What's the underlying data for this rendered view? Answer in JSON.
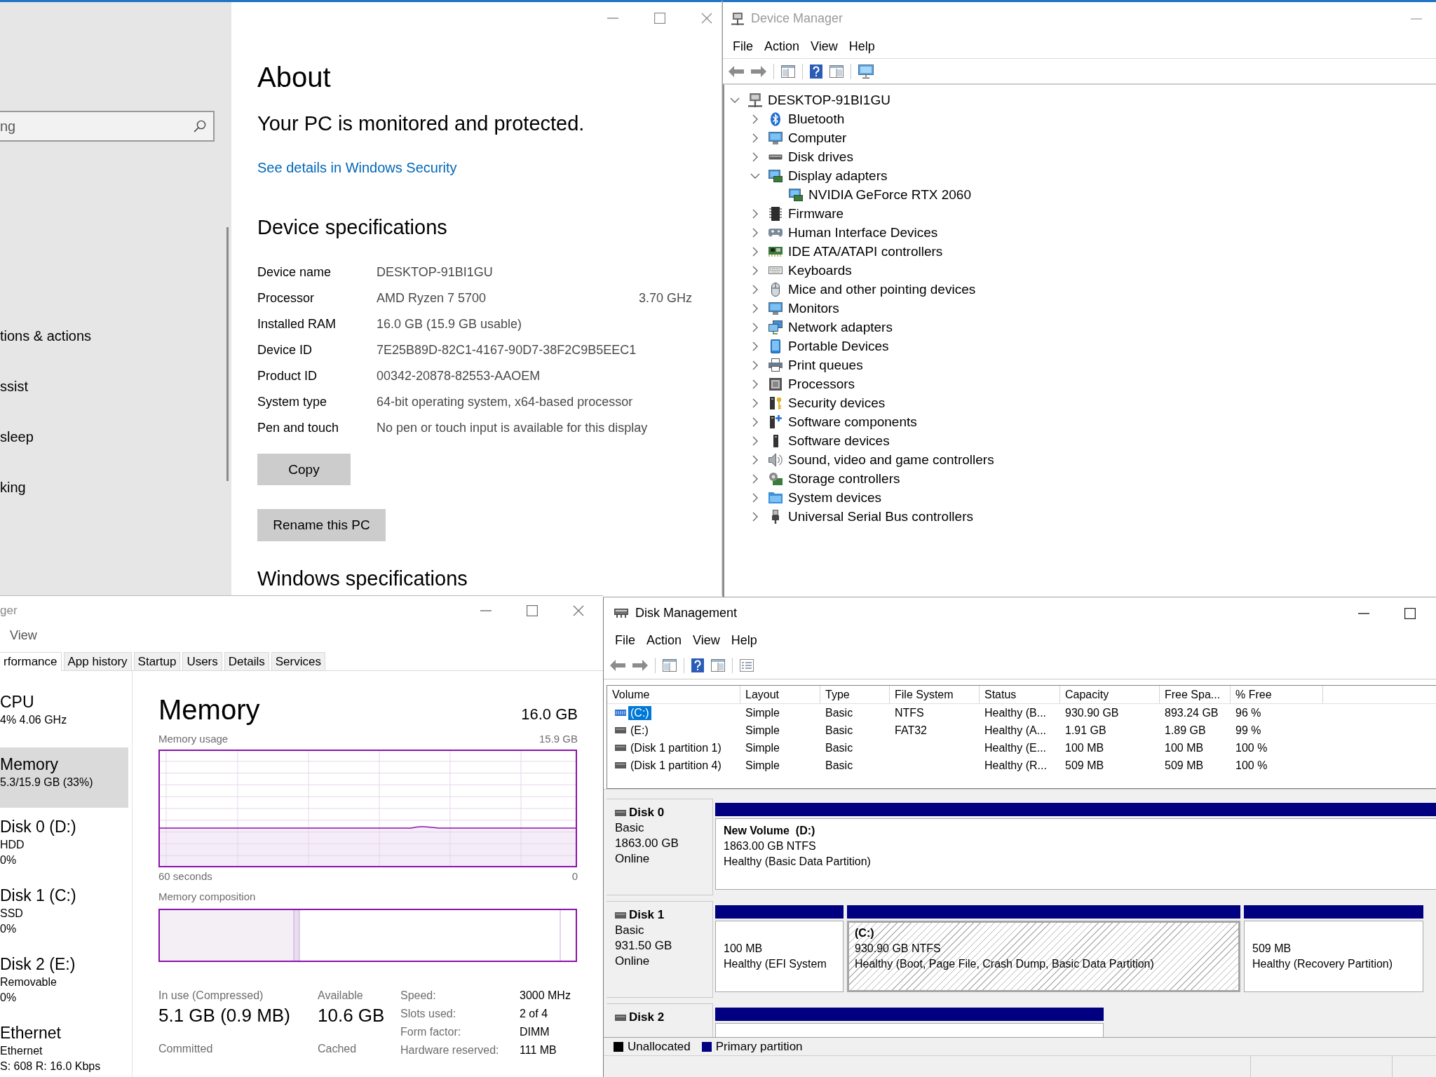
{
  "settings": {
    "sidebar": {
      "search": {
        "placeholder": "ng"
      },
      "items": [
        "tions & actions",
        "ssist",
        "sleep",
        "king"
      ]
    },
    "title": "About",
    "protection_status": "Your PC is monitored and protected.",
    "security_link": "See details in Windows Security",
    "device_specs": {
      "heading": "Device specifications",
      "rows": [
        {
          "label": "Device name",
          "value": "DESKTOP-91BI1GU"
        },
        {
          "label": "Processor",
          "value": "AMD Ryzen 7 5700",
          "clock": "3.70 GHz"
        },
        {
          "label": "Installed RAM",
          "value": "16.0 GB (15.9 GB usable)"
        },
        {
          "label": "Device ID",
          "value": "7E25B89D-82C1-4167-90D7-38F2C9B5EEC1"
        },
        {
          "label": "Product ID",
          "value": "00342-20878-82553-AAOEM"
        },
        {
          "label": "System type",
          "value": "64-bit operating system, x64-based processor"
        },
        {
          "label": "Pen and touch",
          "value": "No pen or touch input is available for this display"
        }
      ],
      "copy_button": "Copy"
    },
    "rename_button": "Rename this PC",
    "windows_specs_heading": "Windows specifications"
  },
  "device_manager": {
    "title": "Device Manager",
    "menu": [
      "File",
      "Action",
      "View",
      "Help"
    ],
    "tree": {
      "label": "DESKTOP-91BI1GU",
      "expanded": true,
      "children": [
        {
          "label": "Bluetooth",
          "expanded": false
        },
        {
          "label": "Computer",
          "expanded": false
        },
        {
          "label": "Disk drives",
          "expanded": false
        },
        {
          "label": "Display adapters",
          "expanded": true,
          "children": [
            {
              "label": "NVIDIA GeForce RTX 2060"
            }
          ]
        },
        {
          "label": "Firmware",
          "expanded": false
        },
        {
          "label": "Human Interface Devices",
          "expanded": false
        },
        {
          "label": "IDE ATA/ATAPI controllers",
          "expanded": false
        },
        {
          "label": "Keyboards",
          "expanded": false
        },
        {
          "label": "Mice and other pointing devices",
          "expanded": false
        },
        {
          "label": "Monitors",
          "expanded": false
        },
        {
          "label": "Network adapters",
          "expanded": false
        },
        {
          "label": "Portable Devices",
          "expanded": false
        },
        {
          "label": "Print queues",
          "expanded": false
        },
        {
          "label": "Processors",
          "expanded": false
        },
        {
          "label": "Security devices",
          "expanded": false
        },
        {
          "label": "Software components",
          "expanded": false
        },
        {
          "label": "Software devices",
          "expanded": false
        },
        {
          "label": "Sound, video and game controllers",
          "expanded": false
        },
        {
          "label": "Storage controllers",
          "expanded": false
        },
        {
          "label": "System devices",
          "expanded": false
        },
        {
          "label": "Universal Serial Bus controllers",
          "expanded": false
        }
      ]
    }
  },
  "task_manager": {
    "title": "ger",
    "menu": [
      "View"
    ],
    "tabs": [
      {
        "label": "rformance",
        "selected": true
      },
      {
        "label": "App history",
        "selected": false
      },
      {
        "label": "Startup",
        "selected": false
      },
      {
        "label": "Users",
        "selected": false
      },
      {
        "label": "Details",
        "selected": false
      },
      {
        "label": "Services",
        "selected": false
      }
    ],
    "resources": [
      {
        "name": "CPU",
        "details": [
          "4% 4.06 GHz"
        ],
        "selected": false
      },
      {
        "name": "Memory",
        "details": [
          "5.3/15.9 GB (33%)"
        ],
        "selected": true
      },
      {
        "name": "Disk 0 (D:)",
        "details": [
          "HDD",
          "0%"
        ],
        "selected": false
      },
      {
        "name": "Disk 1 (C:)",
        "details": [
          "SSD",
          "0%"
        ],
        "selected": false
      },
      {
        "name": "Disk 2 (E:)",
        "details": [
          "Removable",
          "0%"
        ],
        "selected": false
      },
      {
        "name": "Ethernet",
        "details": [
          "Ethernet",
          "S: 608 R: 16.0 Kbps"
        ],
        "selected": false
      }
    ],
    "memory": {
      "title": "Memory",
      "total": "16.0 GB",
      "usage_label": "Memory usage",
      "usage_max": "15.9 GB",
      "time_start": "60 seconds",
      "time_end": "0",
      "composition_label": "Memory composition",
      "stats": [
        {
          "label": "In use (Compressed)",
          "value": "5.1 GB (0.9 MB)"
        },
        {
          "label": "Available",
          "value": "10.6 GB"
        },
        {
          "label": "Committed"
        },
        {
          "label": "Cached"
        }
      ],
      "properties": [
        {
          "label": "Speed:",
          "value": "3000 MHz"
        },
        {
          "label": "Slots used:",
          "value": "2 of 4"
        },
        {
          "label": "Form factor:",
          "value": "DIMM"
        },
        {
          "label": "Hardware reserved:",
          "value": "111 MB"
        }
      ]
    }
  },
  "disk_management": {
    "title": "Disk Management",
    "menu": [
      "File",
      "Action",
      "View",
      "Help"
    ],
    "volumes": {
      "columns": [
        "Volume",
        "Layout",
        "Type",
        "File System",
        "Status",
        "Capacity",
        "Free Spa...",
        "% Free"
      ],
      "rows": [
        {
          "selected": true,
          "volume": "(C:)",
          "layout": "Simple",
          "type": "Basic",
          "file_system": "NTFS",
          "status": "Healthy (B...",
          "capacity": "930.90 GB",
          "free_space": "893.24 GB",
          "percent_free": "96 %"
        },
        {
          "selected": false,
          "volume": "(E:)",
          "layout": "Simple",
          "type": "Basic",
          "file_system": "FAT32",
          "status": "Healthy (A...",
          "capacity": "1.91 GB",
          "free_space": "1.89 GB",
          "percent_free": "99 %"
        },
        {
          "selected": false,
          "volume": "(Disk 1 partition 1)",
          "layout": "Simple",
          "type": "Basic",
          "status": "Healthy (E...",
          "capacity": "100 MB",
          "free_space": "100 MB",
          "percent_free": "100 %"
        },
        {
          "selected": false,
          "volume": "(Disk 1 partition 4)",
          "layout": "Simple",
          "type": "Basic",
          "status": "Healthy (R...",
          "capacity": "509 MB",
          "free_space": "509 MB",
          "percent_free": "100 %"
        }
      ]
    },
    "disks": [
      {
        "name": "Disk 0",
        "type": "Basic",
        "size": "1863.00 GB",
        "status": "Online",
        "partitions": [
          {
            "name": "New Volume  (D:)",
            "size": "1863.00 GB NTFS",
            "status": "Healthy (Basic Data Partition)",
            "selected": false
          }
        ]
      },
      {
        "name": "Disk 1",
        "type": "Basic",
        "size": "931.50 GB",
        "status": "Online",
        "partitions": [
          {
            "size": "100 MB",
            "status": "Healthy (EFI System",
            "selected": false
          },
          {
            "name": "(C:)",
            "size": "930.90 GB NTFS",
            "status": "Healthy (Boot, Page File, Crash Dump, Basic Data Partition)",
            "selected": true
          },
          {
            "size": "509 MB",
            "status": "Healthy (Recovery Partition)",
            "selected": false
          }
        ]
      },
      {
        "name": "Disk 2",
        "partitions": [
          {
            "selected": false
          }
        ]
      }
    ],
    "legend": [
      {
        "label": "Unallocated",
        "color": "#000000"
      },
      {
        "label": "Primary partition",
        "color": "#000080"
      }
    ]
  }
}
